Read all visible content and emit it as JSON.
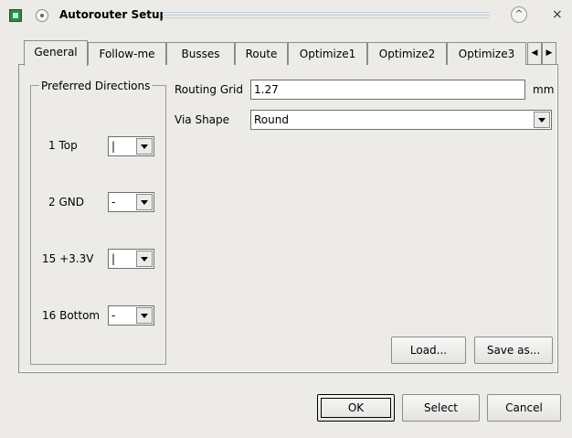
{
  "window": {
    "title": "Autorouter Setup",
    "pin_icon": "pin-icon",
    "maximize_icon": "^",
    "close_icon": "×"
  },
  "tabs": [
    {
      "label": "General",
      "active": true
    },
    {
      "label": "Follow-me"
    },
    {
      "label": "Busses"
    },
    {
      "label": "Route"
    },
    {
      "label": "Optimize1"
    },
    {
      "label": "Optimize2"
    },
    {
      "label": "Optimize3"
    }
  ],
  "tab_scroll": {
    "left": "◀",
    "right": "▶"
  },
  "preferred_directions": {
    "title": "Preferred Directions",
    "layers": [
      {
        "label": "1 Top",
        "value": "|"
      },
      {
        "label": "2 GND",
        "value": "-"
      },
      {
        "label": "15 +3.3V",
        "value": "|"
      },
      {
        "label": "16 Bottom",
        "value": "-"
      }
    ]
  },
  "routing_grid": {
    "label": "Routing Grid",
    "value": "1.27",
    "unit": "mm"
  },
  "via_shape": {
    "label": "Via Shape",
    "value": "Round"
  },
  "buttons": {
    "load": "Load...",
    "save_as": "Save as...",
    "ok": "OK",
    "select": "Select",
    "cancel": "Cancel"
  }
}
